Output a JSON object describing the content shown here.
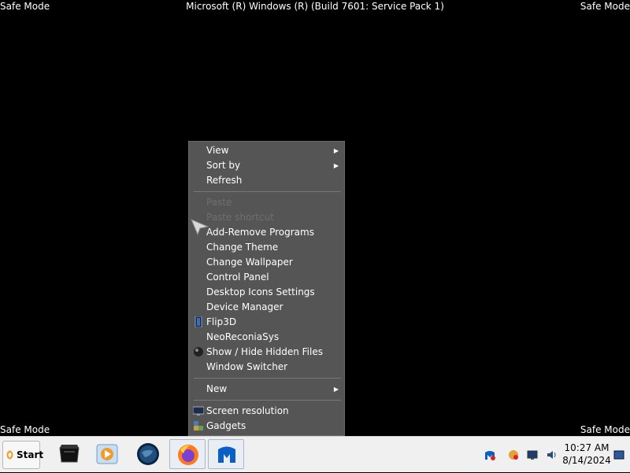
{
  "watermark": {
    "top_left": "Safe Mode",
    "top_right": "Safe Mode",
    "bottom_left": "Safe Mode",
    "bottom_right": "Safe Mode",
    "title": "Microsoft (R) Windows (R) (Build 7601: Service Pack 1)"
  },
  "context_menu": {
    "view": "View",
    "sort_by": "Sort by",
    "refresh": "Refresh",
    "paste": "Paste",
    "paste_shortcut": "Paste shortcut",
    "add_remove": "Add-Remove Programs",
    "change_theme": "Change Theme",
    "change_wallpaper": "Change Wallpaper",
    "control_panel": "Control Panel",
    "desktop_icons": "Desktop Icons Settings",
    "device_manager": "Device Manager",
    "flip3d": "Flip3D",
    "neoreconia": "NeoReconiaSys",
    "show_hide": "Show / Hide Hidden Files",
    "window_switcher": "Window Switcher",
    "new": "New",
    "screen_resolution": "Screen resolution",
    "gadgets": "Gadgets"
  },
  "taskbar": {
    "start_label": "Start",
    "apps": [
      "Cinema/Hardware",
      "Media Player",
      "Browser globe",
      "Firefox",
      "Malwarebytes"
    ],
    "clock_time": "10:27 AM",
    "clock_date": "8/14/2024"
  },
  "colors": {
    "desktop": "#000000",
    "menu_bg": "#555555",
    "disabled_text": "#6f6f6f",
    "taskbar_bg": "#f0f0f0"
  }
}
